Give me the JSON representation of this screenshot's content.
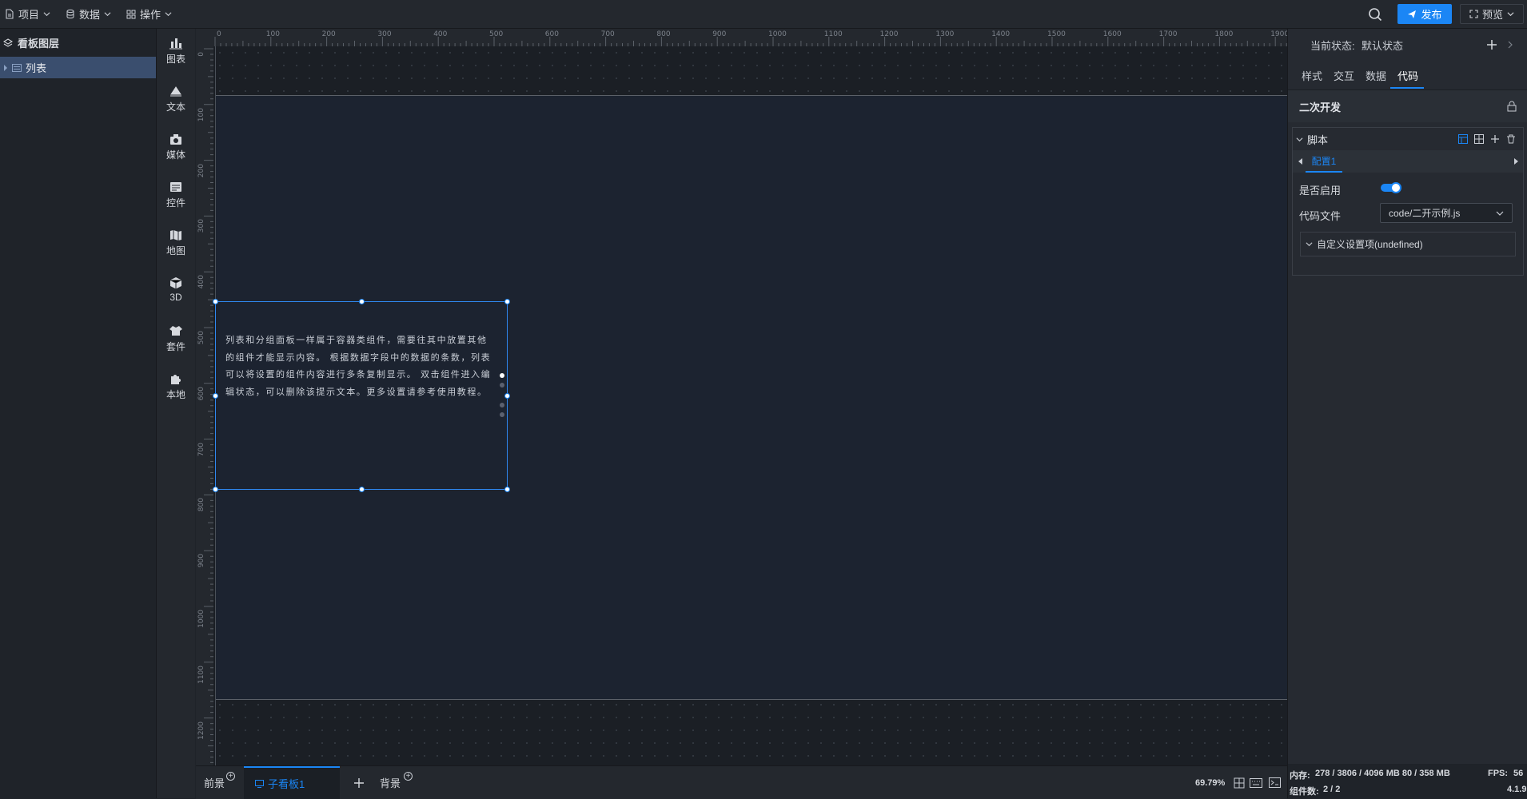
{
  "topbar": {
    "menus": [
      {
        "label": "项目",
        "icon": "file-icon"
      },
      {
        "label": "数据",
        "icon": "database-icon"
      },
      {
        "label": "操作",
        "icon": "grid-icon"
      }
    ],
    "publish_label": "发布",
    "preview_label": "预览"
  },
  "layers": {
    "title": "看板图层",
    "items": [
      {
        "label": "列表"
      }
    ]
  },
  "components": [
    {
      "label": "图表",
      "icon": "chart-icon"
    },
    {
      "label": "文本",
      "icon": "text-icon"
    },
    {
      "label": "媒体",
      "icon": "media-icon"
    },
    {
      "label": "控件",
      "icon": "widget-icon"
    },
    {
      "label": "地图",
      "icon": "map-icon"
    },
    {
      "label": "3D",
      "icon": "cube-icon"
    },
    {
      "label": "套件",
      "icon": "suit-icon"
    },
    {
      "label": "本地",
      "icon": "puzzle-icon"
    }
  ],
  "ruler": {
    "top": [
      "0",
      "100",
      "200",
      "300",
      "400",
      "500",
      "600",
      "700",
      "800",
      "900",
      "1000",
      "1100",
      "1200",
      "1300",
      "1400",
      "1500",
      "1600",
      "1700",
      "1800",
      "1900"
    ],
    "left": [
      "0",
      "100",
      "200",
      "300",
      "400",
      "500",
      "600",
      "700",
      "800",
      "900",
      "1000",
      "1100",
      "1200"
    ]
  },
  "canvas": {
    "list_text": "列表和分组面板一样属于容器类组件，需要往其中放置其他的组件才能显示内容。 根据数据字段中的数据的条数，列表可以将设置的组件内容进行多条复制显示。 双击组件进入编辑状态，可以删除该提示文本。更多设置请参考使用教程。"
  },
  "bottombar": {
    "front_label": "前景",
    "active_tab": "子看板1",
    "back_label": "背景",
    "zoom": "69.79%"
  },
  "rpanel": {
    "state_label": "当前状态:",
    "state_value": "默认状态",
    "tabs": [
      "样式",
      "交互",
      "数据",
      "代码"
    ],
    "active_tab": "代码",
    "section_title": "二次开发",
    "script_title": "脚本",
    "config_tab": "配置1",
    "enable_label": "是否启用",
    "enabled": true,
    "code_file_label": "代码文件",
    "code_file_value": "code/二开示例.js",
    "custom_label": "自定义设置项(undefined)",
    "footer": {
      "memory_label": "内存:",
      "memory_value": "278 / 3806 / 4096 MB  80 / 358 MB",
      "fps_label": "FPS:",
      "fps_value": "56",
      "count_label": "组件数:",
      "count_value": "2 / 2",
      "version": "4.1.9"
    }
  },
  "colors": {
    "accent": "#1b86f5",
    "topbar_bg": "#24282e",
    "board_bg": "#1c2330",
    "selected_layer": "#3a4e6e"
  }
}
